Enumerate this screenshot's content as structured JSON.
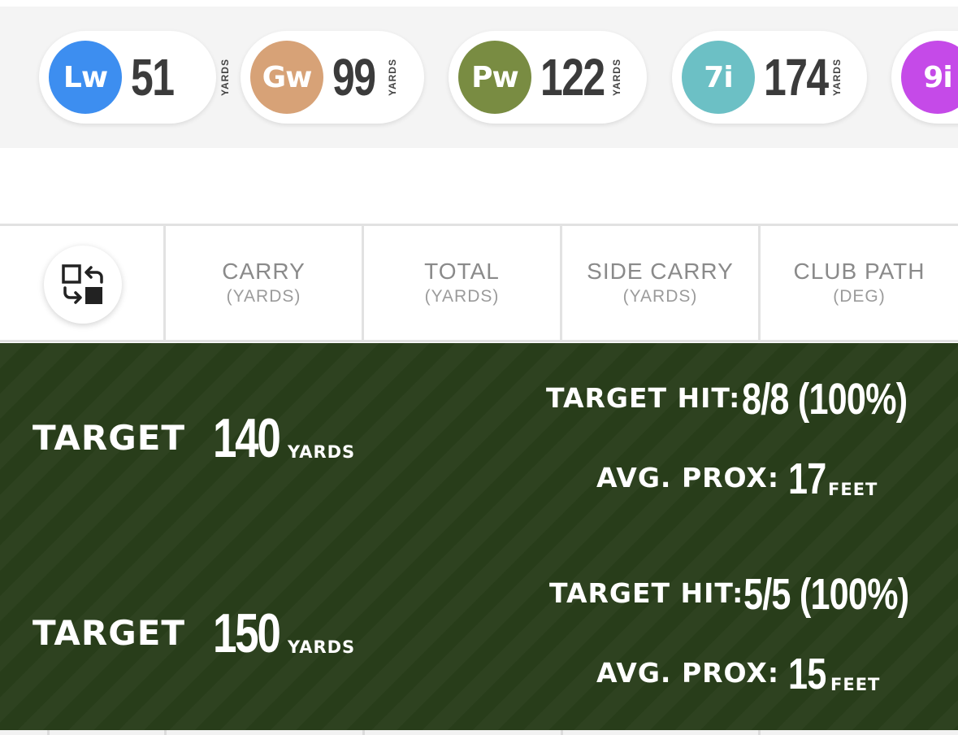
{
  "clubs": [
    {
      "abbr": "Lw",
      "distance": "51",
      "unit": "YARDS",
      "color": "#3d8ef0"
    },
    {
      "abbr": "Gw",
      "distance": "99",
      "unit": "YARDS",
      "color": "#d7a277"
    },
    {
      "abbr": "Pw",
      "distance": "122",
      "unit": "YARDS",
      "color": "#798c42"
    },
    {
      "abbr": "7i",
      "distance": "174",
      "unit": "YARDS",
      "color": "#6cc0c5"
    },
    {
      "abbr": "9i",
      "color": "#c54ae8"
    }
  ],
  "columns": [
    {
      "label": "CARRY",
      "unit": "(YARDS)"
    },
    {
      "label": "TOTAL",
      "unit": "(YARDS)"
    },
    {
      "label": "SIDE CARRY",
      "unit": "(YARDS)"
    },
    {
      "label": "CLUB PATH",
      "unit": "(DEG)"
    }
  ],
  "swap_button": {
    "icon": "swap-icon"
  },
  "targets": [
    {
      "label": "TARGET",
      "distance": "140",
      "unit": "YARDS",
      "hit_label": "TARGET HIT:",
      "hit_value": "8/8 (100%)",
      "prox_label": "AVG. PROX:",
      "prox_value": "17",
      "prox_unit": "FEET"
    },
    {
      "label": "TARGET",
      "distance": "150",
      "unit": "YARDS",
      "hit_label": "TARGET HIT:",
      "hit_value": "5/5 (100%)",
      "prox_label": "AVG. PROX:",
      "prox_value": "15",
      "prox_unit": "FEET"
    }
  ],
  "theme": {
    "panel_bg": "#283d1a",
    "strip_bg": "#f4f4f4",
    "header_text": "#8a8a8a"
  }
}
